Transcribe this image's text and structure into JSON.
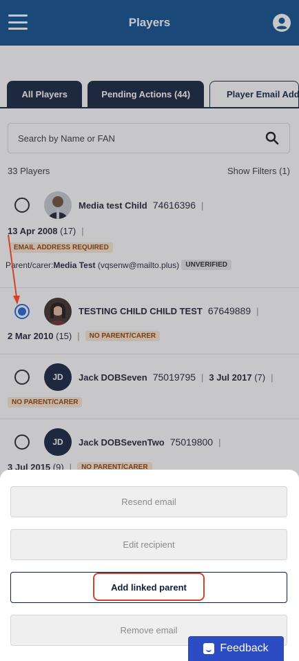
{
  "header": {
    "title": "Players",
    "menu_icon": "hamburger-menu-icon",
    "account_icon": "account-circle-icon",
    "color": "#074a8c"
  },
  "tabs": [
    {
      "label": "All Players"
    },
    {
      "label": "Pending Actions (44)"
    },
    {
      "label": "Player Email Add"
    }
  ],
  "search": {
    "placeholder": "Search by Name or FAN",
    "icon": "search-icon"
  },
  "list_meta": {
    "count": "33 Players",
    "filters": "Show Filters (1)"
  },
  "players": [
    {
      "name": "Media test Child",
      "fan": "74616396",
      "dob": "13 Apr 2008",
      "age": "(17)",
      "badge": "EMAIL ADDRESS REQUIRED",
      "parent_label": "Parent/carer:",
      "parent_name": "Media Test",
      "parent_email": "(vqsenw@mailto.plus)",
      "parent_status": "UNVERIFIED",
      "selected": false
    },
    {
      "name": "TESTING CHILD CHILD TEST",
      "fan": "67649889",
      "dob": "2 Mar 2010",
      "age": "(15)",
      "badge": "NO PARENT/CARER",
      "selected": true
    },
    {
      "name": "Jack DOBSeven",
      "fan": "75019795",
      "dob": "3 Jul 2017",
      "age": "(7)",
      "initials": "JD",
      "badge": "NO PARENT/CARER",
      "selected": false
    },
    {
      "name": "Jack DOBSevenTwo",
      "fan": "75019800",
      "dob": "3 Jul 2015",
      "age": "(9)",
      "initials": "JD",
      "badge": "NO PARENT/CARER",
      "selected": false
    }
  ],
  "sheet": {
    "resend": "Resend email",
    "edit": "Edit recipient",
    "add_parent": "Add linked parent",
    "remove": "Remove email"
  },
  "feedback": {
    "label": "Feedback",
    "color": "#2b4cc2"
  },
  "annotation": {
    "highlight_color": "#d3412d"
  }
}
